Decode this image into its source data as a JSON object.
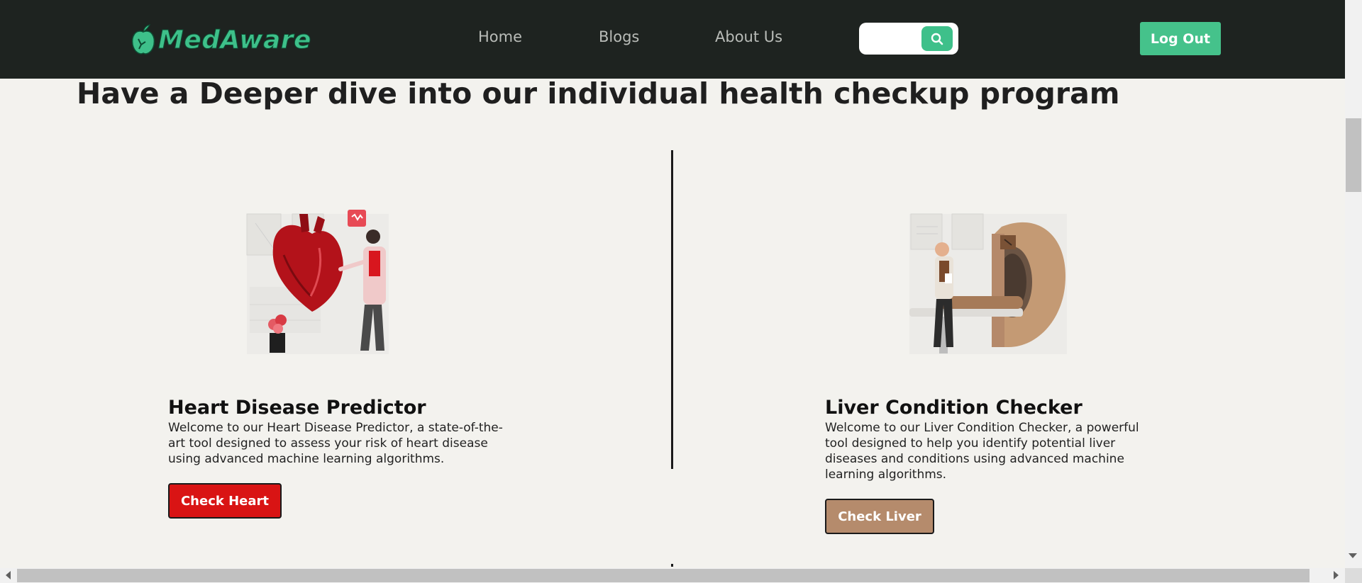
{
  "brand": {
    "name": "MedAware",
    "accent": "#3ec08a"
  },
  "nav": {
    "items": [
      {
        "label": "Home"
      },
      {
        "label": "Blogs"
      },
      {
        "label": "About Us"
      }
    ],
    "search": {
      "placeholder": "",
      "icon": "search-icon"
    },
    "logout_label": "Log Out"
  },
  "main": {
    "title": "Have a Deeper dive into our individual health checkup program",
    "cards": [
      {
        "title": "Heart Disease Predictor",
        "description": "Welcome to our Heart Disease Predictor, a state-of-the-art tool designed to assess your risk of heart disease using advanced machine learning algorithms.",
        "button_label": "Check Heart",
        "button_color": "#d91414",
        "illustration": "heart-doctor-illustration"
      },
      {
        "title": "Liver Condition Checker",
        "description": "Welcome to our Liver Condition Checker, a powerful tool designed to help you identify potential liver diseases and conditions using advanced machine learning algorithms.",
        "button_label": "Check Liver",
        "button_color": "#b58b6c",
        "illustration": "mri-scanner-illustration"
      }
    ]
  }
}
